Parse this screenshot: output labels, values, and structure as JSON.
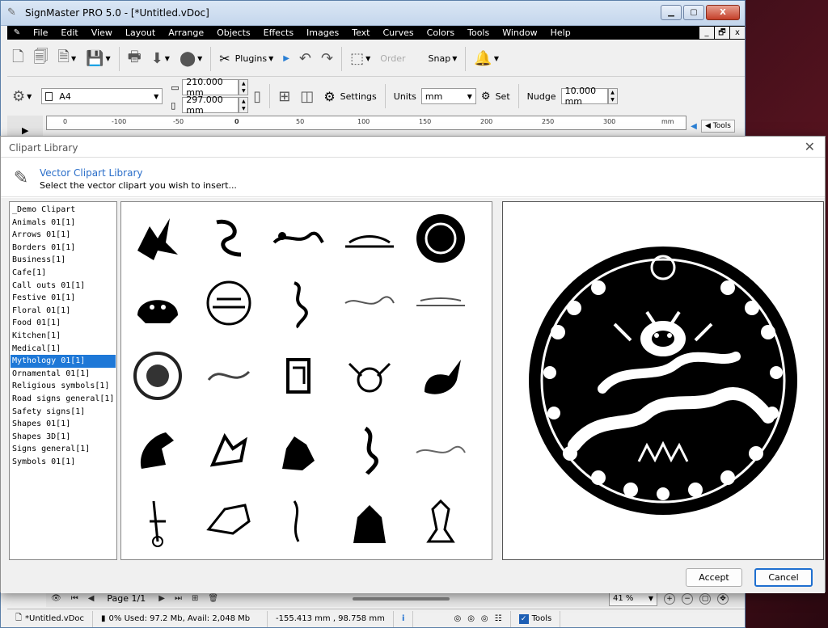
{
  "app": {
    "title": "SignMaster PRO 5.0 - [*Untitled.vDoc]",
    "window_buttons": [
      "▁",
      "▢",
      "X"
    ],
    "menu": [
      "File",
      "Edit",
      "View",
      "Layout",
      "Arrange",
      "Objects",
      "Effects",
      "Images",
      "Text",
      "Curves",
      "Colors",
      "Tools",
      "Window",
      "Help"
    ],
    "mdi_buttons": [
      "_",
      "🗗",
      "x"
    ]
  },
  "toolbar1": {
    "plugins_label": "Plugins",
    "order_label": "Order",
    "snap_label": "Snap"
  },
  "toolbar2": {
    "page_size": "A4",
    "width_value": "210.000 mm",
    "height_value": "297.000 mm",
    "settings_label": "Settings",
    "units_label": "Units",
    "units_value": "mm",
    "set_label": "Set",
    "nudge_label": "Nudge",
    "nudge_value": "10.000 mm"
  },
  "ruler": {
    "ticks": [
      "0",
      "-100",
      "-50",
      "0",
      "50",
      "100",
      "150",
      "200",
      "250",
      "300",
      "mm"
    ]
  },
  "sidepanel": {
    "tools_label": "Tools"
  },
  "dialog": {
    "title": "Clipart Library",
    "heading": "Vector Clipart Library",
    "subheading": "Select the vector clipart you wish to insert...",
    "categories": [
      "_Demo Clipart",
      "Animals 01[1]",
      "Arrows 01[1]",
      "Borders 01[1]",
      "Business[1]",
      "Cafe[1]",
      "Call outs 01[1]",
      "Festive 01[1]",
      "Floral 01[1]",
      "Food 01[1]",
      "Kitchen[1]",
      "Medical[1]",
      "Mythology 01[1]",
      "Ornamental 01[1]",
      "Religious symbols[1]",
      "Road signs general[1]",
      "Safety signs[1]",
      "Shapes 01[1]",
      "Shapes 3D[1]",
      "Signs general[1]",
      "Symbols 01[1]"
    ],
    "selected_category": "Mythology 01[1]",
    "accept_label": "Accept",
    "cancel_label": "Cancel"
  },
  "bottombar": {
    "page_label": "Page 1/1",
    "zoom_value": "41 %"
  },
  "statusbar": {
    "doc_name": "*Untitled.vDoc",
    "memory": "0%  Used: 97.2 Mb, Avail: 2,048 Mb",
    "coords": "-155.413 mm , 98.758 mm",
    "tools_label": "Tools"
  }
}
